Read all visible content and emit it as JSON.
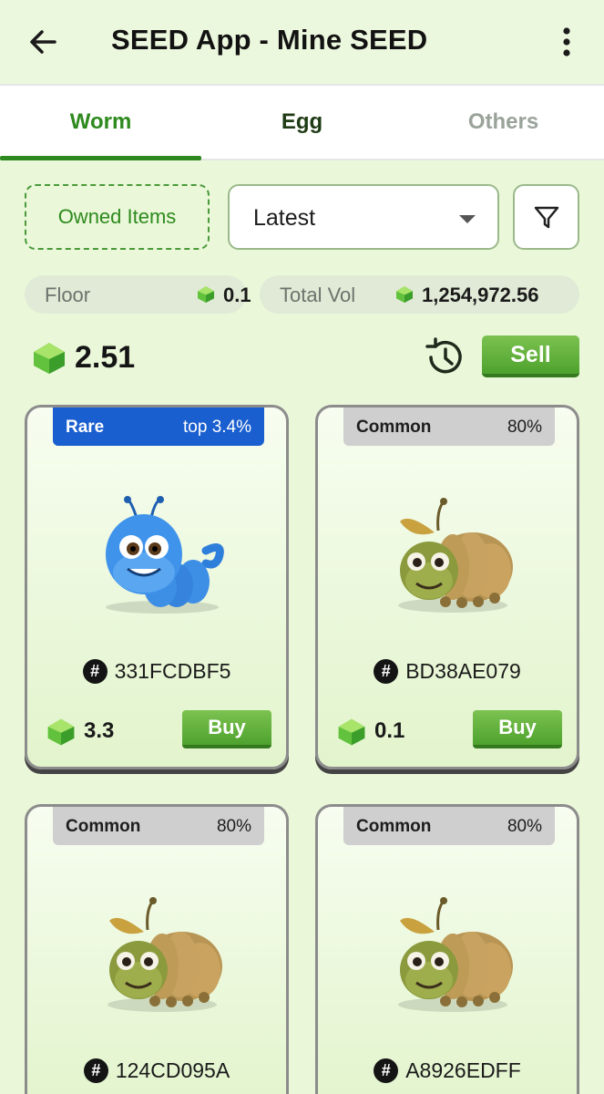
{
  "header": {
    "title": "SEED App - Mine SEED",
    "back_icon": "arrow-left-icon",
    "menu_icon": "more-vertical-icon"
  },
  "tabs": [
    {
      "label": "Worm",
      "active": true
    },
    {
      "label": "Egg",
      "active": false
    },
    {
      "label": "Others",
      "active": false
    }
  ],
  "controls": {
    "owned_label": "Owned Items",
    "sort_value": "Latest",
    "filter_icon": "filter-icon"
  },
  "stats": {
    "floor_label": "Floor",
    "floor_value": "0.1",
    "volume_label": "Total Vol",
    "volume_value": "1,254,972.56"
  },
  "balance": {
    "value": "2.51",
    "sell_label": "Sell",
    "history_icon": "history-icon"
  },
  "colors": {
    "accent": "#2e8a1e",
    "button": "#4ea22d",
    "rare": "#1a5fcf",
    "common": "#cfcfcf",
    "background": "#eaf7d9"
  },
  "items": [
    {
      "rarity": "Rare",
      "percent": "top 3.4%",
      "id": "331FCDBF5",
      "price": "3.3",
      "buy_label": "Buy",
      "creature": "blue-worm"
    },
    {
      "rarity": "Common",
      "percent": "80%",
      "id": "BD38AE079",
      "price": "0.1",
      "buy_label": "Buy",
      "creature": "leaf-worm"
    },
    {
      "rarity": "Common",
      "percent": "80%",
      "id": "124CD095A",
      "price": "",
      "buy_label": "",
      "creature": "leaf-worm"
    },
    {
      "rarity": "Common",
      "percent": "80%",
      "id": "A8926EDFF",
      "price": "",
      "buy_label": "",
      "creature": "leaf-worm"
    }
  ]
}
